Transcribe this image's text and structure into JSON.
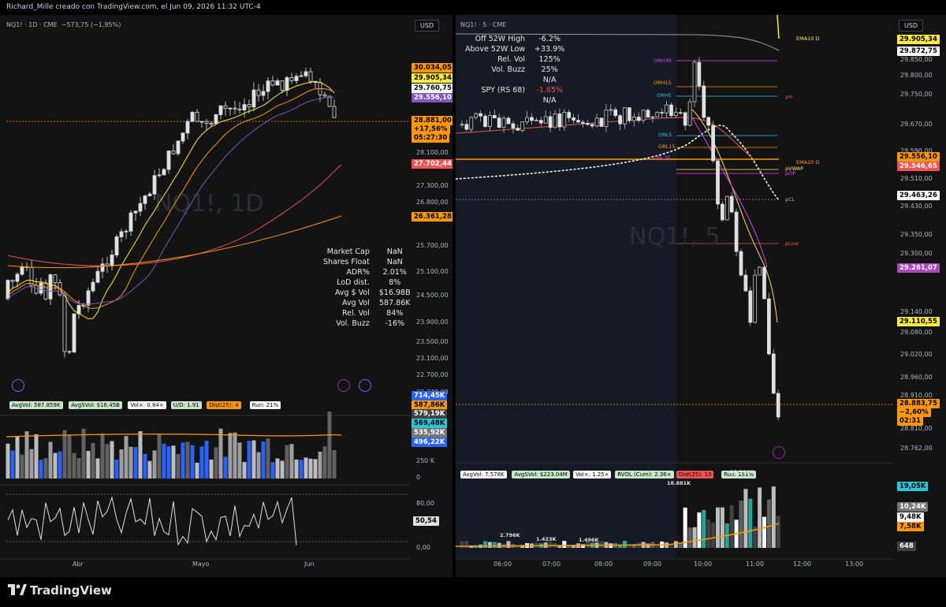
{
  "header": {
    "title": "Richard_Mille creado con TradingView.com, el Jun 09, 2026 11:32 UTC-4"
  },
  "left": {
    "symbol": "NQ1! · 1D · CME",
    "change": "−573,75 (−1,95%)",
    "currency": "USD",
    "watermark": "NQ1!, 1D",
    "price_axis": [
      "29.550,00",
      "28.100,00",
      "27.300,00",
      "26.800,00",
      "25.700,00",
      "25.100,00",
      "24.500,00",
      "23.900,00",
      "23.500,00",
      "23.100,00",
      "22.700,00",
      "22.320,00"
    ],
    "tags": [
      {
        "text": "30.034,05",
        "bg": "#ff9800",
        "fg": "#000"
      },
      {
        "text": "29.905,34",
        "bg": "#ffeb3b",
        "fg": "#000"
      },
      {
        "text": "29.760,75",
        "bg": "#ffffff",
        "fg": "#000"
      },
      {
        "text": "29.556,10",
        "bg": "#7e57c2",
        "fg": "#fff"
      },
      {
        "text": "28.881,00",
        "bg": "#ff9800",
        "fg": "#000"
      },
      {
        "text": "+17,56%",
        "bg": "#ff9800",
        "fg": "#000"
      },
      {
        "text": "05:27:30",
        "bg": "#ff9800",
        "fg": "#000"
      },
      {
        "text": "27.702,44",
        "bg": "#ef5350",
        "fg": "#fff"
      },
      {
        "text": "26.361,28",
        "bg": "#ff9800",
        "fg": "#000"
      }
    ],
    "stats": [
      {
        "k": "Market Cap",
        "v": "NaN"
      },
      {
        "k": "Shares Float",
        "v": "NaN"
      },
      {
        "k": "ADR%",
        "v": "2.01%"
      },
      {
        "k": "LoD dist.",
        "v": "8%"
      },
      {
        "k": "Avg $ Vol",
        "v": "$16.98B"
      },
      {
        "k": "Avg Vol",
        "v": "587.86K"
      },
      {
        "k": "Rel. Vol",
        "v": "84%"
      },
      {
        "k": "Vol. Buzz",
        "v": "-16%"
      }
    ],
    "vol_pills": [
      {
        "text": "AvgVol: 587.859K",
        "bg": "#c8e6c9"
      },
      {
        "text": "AvgSVol: $16.45B",
        "bg": "#c8e6c9"
      },
      {
        "text": "Vol×: 0.84×",
        "bg": "#ffffff"
      },
      {
        "text": "U/D: 1.91",
        "bg": "#c8e6c9"
      },
      {
        "text": "Dist(25): 4",
        "bg": "#ff9800"
      },
      {
        "text": "Run: 21%",
        "bg": "#ffffff"
      }
    ],
    "vol_tags": [
      {
        "text": "714,45K",
        "bg": "#2962ff",
        "fg": "#fff"
      },
      {
        "text": "587,86K",
        "bg": "#ff9800",
        "fg": "#000"
      },
      {
        "text": "579,19K",
        "bg": "#424242",
        "fg": "#fff"
      },
      {
        "text": "569,48K",
        "bg": "#26c6da",
        "fg": "#000"
      },
      {
        "text": "535,92K",
        "bg": "#757575",
        "fg": "#fff"
      },
      {
        "text": "496,22K",
        "bg": "#2962ff",
        "fg": "#fff"
      }
    ],
    "vol_axis": [
      "250 K",
      "0"
    ],
    "osc_axis": [
      "80,00",
      "0,00"
    ],
    "osc_tag": "50,54",
    "x_axis": [
      "Abr",
      "Mayo",
      "Jun"
    ]
  },
  "right": {
    "symbol": "NQ1! · 5 · CME",
    "currency": "USD",
    "watermark": "NQ1!, 5",
    "stats": [
      {
        "k": "Off 52W High",
        "v": "-6.2%",
        "c": "#e8e8e8"
      },
      {
        "k": "Above 52W Low",
        "v": "+33.9%",
        "c": "#e8e8e8"
      },
      {
        "k": "Rel. Vol",
        "v": "125%",
        "c": "#e8e8e8"
      },
      {
        "k": "Vol. Buzz",
        "v": "25%",
        "c": "#e8e8e8"
      },
      {
        "k": "",
        "v": "N/A",
        "c": "#e8e8e8"
      },
      {
        "k": "SPY (RS 68)",
        "v": "-1.65%",
        "c": "#ef5350"
      },
      {
        "k": "",
        "v": "N/A",
        "c": "#e8e8e8"
      }
    ],
    "price_axis": [
      "29.850,00",
      "29.800,00",
      "29.750,00",
      "29.670,00",
      "29.590,00",
      "29.510,00",
      "29.430,00",
      "29.350,00",
      "29.300,00",
      "29.140,00",
      "29.080,00",
      "29.020,00",
      "28.960,00",
      "28.910,00",
      "28.810,00",
      "28.762,00"
    ],
    "tags": [
      {
        "text": "29.905,34",
        "bg": "#ffeb3b",
        "fg": "#000"
      },
      {
        "text": "29.872,75",
        "bg": "#ffffff",
        "fg": "#000"
      },
      {
        "text": "29.556,10",
        "bg": "#ff9800",
        "fg": "#000"
      },
      {
        "text": "29.546,65",
        "bg": "#ef5350",
        "fg": "#fff"
      },
      {
        "text": "29.463,26",
        "bg": "#ffffff",
        "fg": "#000"
      },
      {
        "text": "29.261,07",
        "bg": "#ab47bc",
        "fg": "#fff"
      },
      {
        "text": "29.110,55",
        "bg": "#ffeb3b",
        "fg": "#000"
      },
      {
        "text": "28.883,75",
        "bg": "#ff9800",
        "fg": "#000"
      },
      {
        "text": "−2,60%",
        "bg": "#ff9800",
        "fg": "#000"
      },
      {
        "text": "02:31",
        "bg": "#ff9800",
        "fg": "#000"
      }
    ],
    "levels": [
      {
        "name": "EMA10 D",
        "color": "#ffeb3b"
      },
      {
        "name": "ORH30",
        "color": "#e040fb"
      },
      {
        "name": "ORH15",
        "color": "#ff9800"
      },
      {
        "name": "ORH5",
        "color": "#26c6da"
      },
      {
        "name": "pH",
        "color": "#ef5350"
      },
      {
        "name": "ORL5",
        "color": "#26c6da"
      },
      {
        "name": "ORL15",
        "color": "#ff9800"
      },
      {
        "name": "ORL30",
        "color": "#e040fb"
      },
      {
        "name": "EMA20 D",
        "color": "#ff9800"
      },
      {
        "name": "pVWAP",
        "color": "#ffeb3b"
      },
      {
        "name": "pOP",
        "color": "#e040fb"
      },
      {
        "name": "pCL",
        "color": "#b2b5be"
      },
      {
        "name": "pLow",
        "color": "#ef5350"
      }
    ],
    "vol_pills": [
      {
        "text": "AvgVol: 7.578K",
        "bg": "#ffffff"
      },
      {
        "text": "AvgSVol: $223.04M",
        "bg": "#c8e6c9"
      },
      {
        "text": "Vol×: 1.25×",
        "bg": "#ffffff"
      },
      {
        "text": "RVOL (Cum): 2.36×",
        "bg": "#c8e6c9"
      },
      {
        "text": "Dist(25): 13",
        "bg": "#ef5350"
      },
      {
        "text": "Run: 151%",
        "bg": "#c8e6c9"
      }
    ],
    "vol_peaks": [
      "18.881K",
      "22.304K",
      "2.796K",
      "1.423K",
      "1.496K"
    ],
    "vol_tags": [
      {
        "text": "19,05K",
        "bg": "#26c6da",
        "fg": "#000"
      },
      {
        "text": "10,24K",
        "bg": "#757575",
        "fg": "#fff"
      },
      {
        "text": "9,48K",
        "bg": "#ffffff",
        "fg": "#000"
      },
      {
        "text": "7,58K",
        "bg": "#ff9800",
        "fg": "#000"
      },
      {
        "text": "648",
        "bg": "#424242",
        "fg": "#fff"
      }
    ],
    "x_axis": [
      "06:00",
      "07:00",
      "08:00",
      "09:00",
      "10:00",
      "11:00",
      "12:00",
      "13:00"
    ]
  },
  "footer": {
    "brand": "TradingView"
  }
}
